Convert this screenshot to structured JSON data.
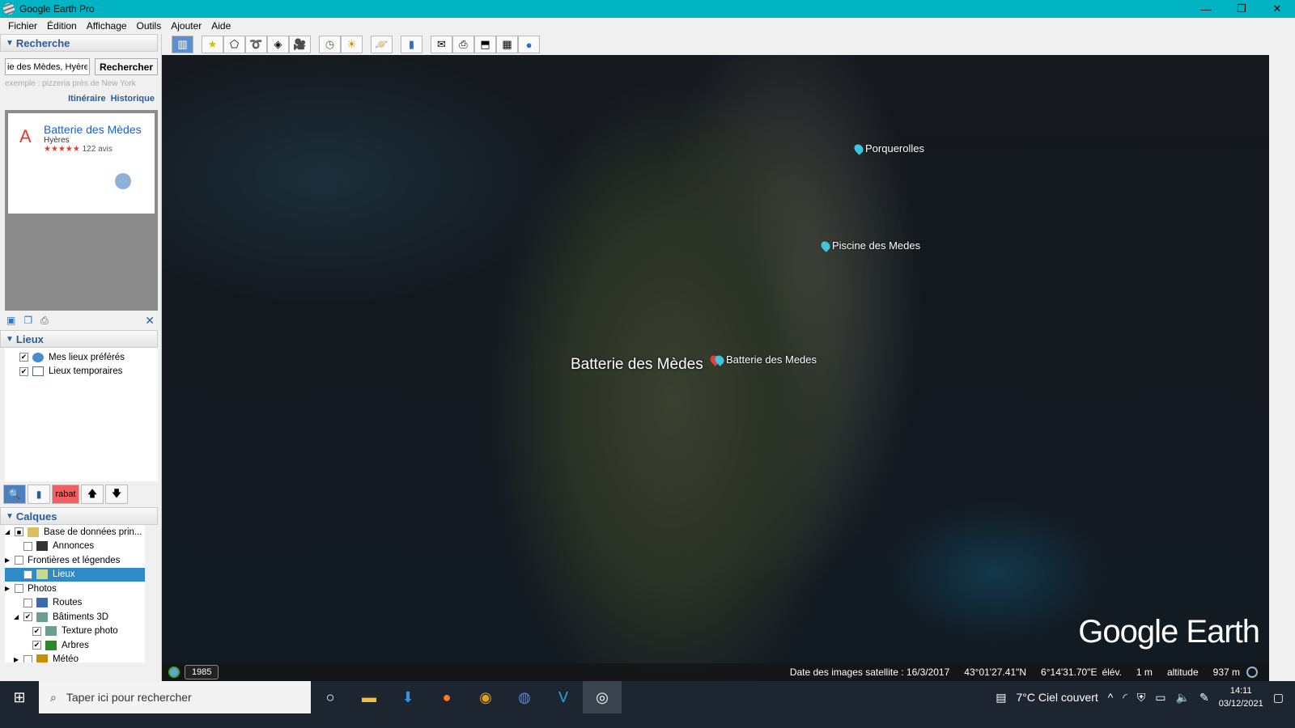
{
  "window": {
    "title": "Google Earth Pro",
    "min": "—",
    "max": "❐",
    "close": "✕"
  },
  "menu": [
    "Fichier",
    "Édition",
    "Affichage",
    "Outils",
    "Ajouter",
    "Aide"
  ],
  "search": {
    "header": "Recherche",
    "value": "ie des Mèdes, Hyères",
    "button": "Rechercher",
    "hint": "exemple : pizzeria près de New York",
    "link_route": "Itinéraire",
    "link_history": "Historique",
    "result": {
      "letter": "A",
      "name": "Batterie des Mèdes",
      "locality": "Hyères",
      "stars": "★★★★★",
      "reviews": "122 avis"
    }
  },
  "places": {
    "header": "Lieux",
    "items": [
      {
        "label": "Mes lieux préférés",
        "checked": true
      },
      {
        "label": "Lieux temporaires",
        "checked": true
      }
    ]
  },
  "nav": {
    "tag": "rabat",
    "up": "🡅",
    "down": "🡇"
  },
  "layers": {
    "header": "Calques",
    "items": [
      {
        "label": "Base de données prin...",
        "expander": "◢",
        "check": "■"
      },
      {
        "label": "Annonces",
        "expander": "",
        "check": ""
      },
      {
        "label": "Frontières et légendes",
        "expander": "▶",
        "check": ""
      },
      {
        "label": "Lieux",
        "expander": "",
        "check": "✔"
      },
      {
        "label": "Photos",
        "expander": "▶",
        "check": ""
      },
      {
        "label": "Routes",
        "expander": "",
        "check": ""
      },
      {
        "label": "Bâtiments 3D",
        "expander": "◢",
        "check": "✔"
      },
      {
        "label": "Texture photo",
        "expander": "",
        "check": "✔"
      },
      {
        "label": "Arbres",
        "expander": "",
        "check": "✔"
      },
      {
        "label": "Météo",
        "expander": "▶",
        "check": ""
      }
    ]
  },
  "map": {
    "main_label": "Batterie des Mèdes",
    "placemarks": [
      "Porquerolles",
      "Piscine des Medes",
      "Batterie des Medes"
    ],
    "watermark": "Google Earth",
    "year": "1985",
    "status": {
      "date": "Date des images satellite : 16/3/2017",
      "lat": "43°01'27.41\"N",
      "lon": "6°14'31.70\"E",
      "elev_label": "élév.",
      "elev": "1 m",
      "alt_label": "altitude",
      "alt": "937 m"
    }
  },
  "taskbar": {
    "search_placeholder": "Taper ici pour rechercher",
    "weather": "7°C  Ciel couvert",
    "time": "14:11",
    "date": "03/12/2021"
  }
}
